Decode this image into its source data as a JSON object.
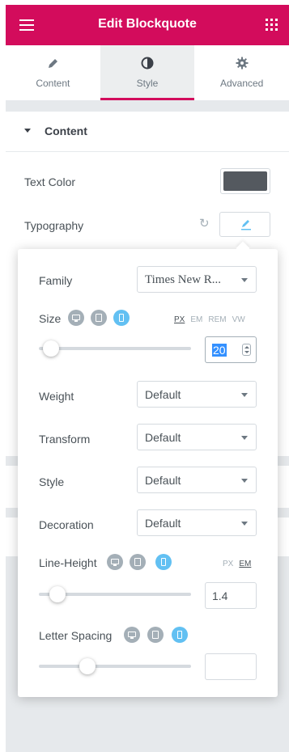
{
  "header": {
    "title": "Edit Blockquote",
    "menu_icon": "hamburger-icon",
    "apps_icon": "grid-icon",
    "color": "#d30c5c"
  },
  "tabs": [
    {
      "label": "Content",
      "icon": "pencil-icon",
      "active": false
    },
    {
      "label": "Style",
      "icon": "half-circle-icon",
      "active": true
    },
    {
      "label": "Advanced",
      "icon": "gear-icon",
      "active": false
    }
  ],
  "section": {
    "title": "Content"
  },
  "text_color": {
    "label": "Text Color",
    "value": "#54595f"
  },
  "typography": {
    "label": "Typography"
  },
  "popover": {
    "family": {
      "label": "Family",
      "value": "Times New R..."
    },
    "size": {
      "label": "Size",
      "units": [
        "PX",
        "EM",
        "REM",
        "VW"
      ],
      "active_unit": "PX",
      "value": "20",
      "slider_fraction": 0.08
    },
    "weight": {
      "label": "Weight",
      "value": "Default"
    },
    "transform": {
      "label": "Transform",
      "value": "Default"
    },
    "style": {
      "label": "Style",
      "value": "Default"
    },
    "decoration": {
      "label": "Decoration",
      "value": "Default"
    },
    "line_height": {
      "label": "Line-Height",
      "units": [
        "PX",
        "EM"
      ],
      "active_unit": "EM",
      "value": "1.4",
      "slider_fraction": 0.12
    },
    "letter_spacing": {
      "label": "Letter Spacing",
      "value": "",
      "slider_fraction": 0.32
    }
  }
}
